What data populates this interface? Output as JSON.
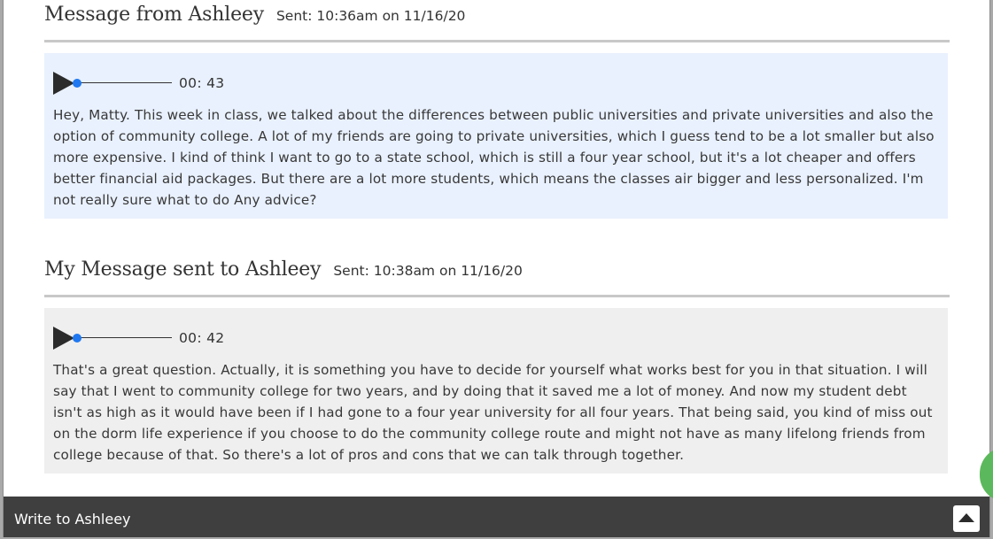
{
  "messages": [
    {
      "title": "Message from Ashleey",
      "sent": "Sent: 10:36am on 11/16/20",
      "duration": "00: 43",
      "body": "Hey, Matty. This week in class, we talked about the differences between public universities and private universities and also the option of community college. A lot of my friends are going to private universities, which I guess tend to be a lot smaller but also more expensive. I kind of think I want to go to a state school, which is still a four year school, but it's a lot cheaper and offers better financial aid packages. But there are a lot more students, which means the classes air bigger and less personalized. I'm not really sure what to do Any advice?",
      "box_color": "#e9f1fe"
    },
    {
      "title": "My Message sent to Ashleey",
      "sent": "Sent: 10:38am on 11/16/20",
      "duration": "00: 42",
      "body": "That's a great question. Actually, it is something you have to decide for yourself what works best for you in that situation. I will say that I went to community college for two years, and by doing that it saved me a lot of money. And now my student debt isn't as high as it would have been if I had gone to a four year university for all four years. That being said, you kind of miss out on the dorm life experience if you choose to do the community college route and might not have as many lifelong friends from college because of that. So there's a lot of pros and cons that we can talk through together.",
      "box_color": "#efefef"
    }
  ],
  "footer": {
    "label": "Write to Ashleey",
    "collapse_icon": "chevron-up-icon"
  },
  "colors": {
    "accent_blue": "#1f78f0",
    "footer_bg": "#3f3f3f",
    "side_tab": "#5cb85c"
  }
}
